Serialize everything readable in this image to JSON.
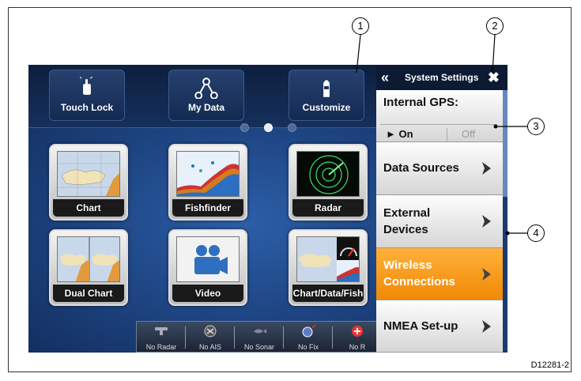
{
  "figure_id": "D12281-2",
  "callouts": [
    "1",
    "2",
    "3",
    "4"
  ],
  "top_buttons": [
    {
      "label": "Touch Lock",
      "icon": "hand-touch-icon"
    },
    {
      "label": "My Data",
      "icon": "data-network-icon"
    },
    {
      "label": "Customize",
      "icon": "boat-icon"
    }
  ],
  "page_dots": {
    "count": 3,
    "active_index": 1
  },
  "apps": [
    {
      "label": "Chart",
      "icon": "chart-thumbnail"
    },
    {
      "label": "Fishfinder",
      "icon": "fishfinder-thumbnail"
    },
    {
      "label": "Radar",
      "icon": "radar-thumbnail"
    },
    {
      "label": "Dual Chart",
      "icon": "dual-chart-thumbnail"
    },
    {
      "label": "Video",
      "icon": "video-camera-icon"
    },
    {
      "label": "Chart/Data/Fish",
      "icon": "chart-data-fish-thumbnail"
    }
  ],
  "status_bar": [
    {
      "label": "No Radar",
      "icon": "radar-scanner-icon"
    },
    {
      "label": "No AIS",
      "icon": "ais-icon"
    },
    {
      "label": "No Sonar",
      "icon": "sonar-fish-icon"
    },
    {
      "label": "No Fix",
      "icon": "gps-fix-icon"
    },
    {
      "label": "No R",
      "icon": "alarm-icon"
    }
  ],
  "menu": {
    "title": "System Settings",
    "back_icon": "double-chevron-left-icon",
    "close_icon": "close-x-icon",
    "gps": {
      "label": "Internal GPS:",
      "on_label": "► On",
      "off_label": "Off",
      "value": "On"
    },
    "items": [
      {
        "label": "Data Sources",
        "selected": false
      },
      {
        "label": "External Devices",
        "line1": "External",
        "line2": "Devices",
        "selected": false
      },
      {
        "label": "Wireless Connections",
        "line1": "Wireless",
        "line2": "Connections",
        "selected": true
      },
      {
        "label": "NMEA Set-up",
        "selected": false
      }
    ]
  },
  "colors": {
    "selected": "#f39a14",
    "screen_bg": "#1d4380",
    "menu_header": "#0c1a33"
  }
}
